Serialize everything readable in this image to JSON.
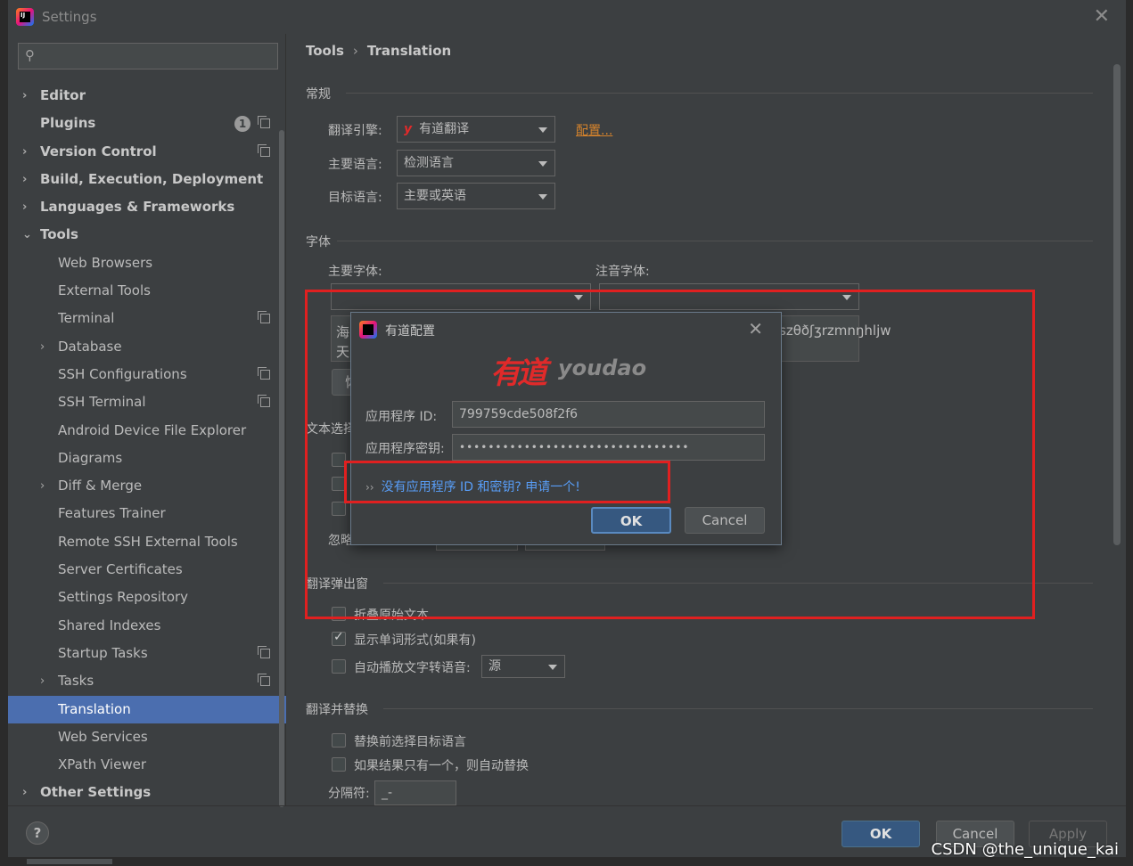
{
  "window": {
    "title": "Settings"
  },
  "search": {
    "placeholder": ""
  },
  "sidebar": {
    "items": [
      {
        "label": "Editor",
        "arrow": "›",
        "bold": true,
        "indent": 0,
        "selected": false
      },
      {
        "label": "Plugins",
        "arrow": "",
        "bold": true,
        "indent": 0,
        "badge": "1",
        "copy": true
      },
      {
        "label": "Version Control",
        "arrow": "›",
        "bold": true,
        "indent": 0,
        "copy": true
      },
      {
        "label": "Build, Execution, Deployment",
        "arrow": "›",
        "bold": true,
        "indent": 0
      },
      {
        "label": "Languages & Frameworks",
        "arrow": "›",
        "bold": true,
        "indent": 0
      },
      {
        "label": "Tools",
        "arrow": "⌄",
        "bold": true,
        "indent": 0
      },
      {
        "label": "Web Browsers",
        "arrow": "",
        "indent": 1
      },
      {
        "label": "External Tools",
        "arrow": "",
        "indent": 1
      },
      {
        "label": "Terminal",
        "arrow": "",
        "indent": 1,
        "copy": true
      },
      {
        "label": "Database",
        "arrow": "›",
        "indent": 1
      },
      {
        "label": "SSH Configurations",
        "arrow": "",
        "indent": 1,
        "copy": true
      },
      {
        "label": "SSH Terminal",
        "arrow": "",
        "indent": 1,
        "copy": true
      },
      {
        "label": "Android Device File Explorer",
        "arrow": "",
        "indent": 1
      },
      {
        "label": "Diagrams",
        "arrow": "",
        "indent": 1
      },
      {
        "label": "Diff & Merge",
        "arrow": "›",
        "indent": 1
      },
      {
        "label": "Features Trainer",
        "arrow": "",
        "indent": 1
      },
      {
        "label": "Remote SSH External Tools",
        "arrow": "",
        "indent": 1
      },
      {
        "label": "Server Certificates",
        "arrow": "",
        "indent": 1
      },
      {
        "label": "Settings Repository",
        "arrow": "",
        "indent": 1
      },
      {
        "label": "Shared Indexes",
        "arrow": "",
        "indent": 1
      },
      {
        "label": "Startup Tasks",
        "arrow": "",
        "indent": 1,
        "copy": true
      },
      {
        "label": "Tasks",
        "arrow": "›",
        "indent": 1,
        "copy": true
      },
      {
        "label": "Translation",
        "arrow": "",
        "indent": 1,
        "selected": true
      },
      {
        "label": "Web Services",
        "arrow": "",
        "indent": 1
      },
      {
        "label": "XPath Viewer",
        "arrow": "",
        "indent": 1
      },
      {
        "label": "Other Settings",
        "arrow": "›",
        "bold": true,
        "indent": 0
      }
    ]
  },
  "breadcrumb": {
    "parent": "Tools",
    "sep": "›",
    "current": "Translation"
  },
  "general": {
    "title": "常规",
    "engine_label": "翻译引擎:",
    "engine_value": "有道翻译",
    "engine_icon": "y",
    "config_link": "配置...",
    "primary_lang_label": "主要语言:",
    "primary_lang_value": "检测语言",
    "target_lang_label": "目标语言:",
    "target_lang_value": "主要或英语"
  },
  "font": {
    "title": "字体",
    "primary_label": "主要字体:",
    "phonetic_label": "注音字体:",
    "preview_line1": "海",
    "preview_line2": "天",
    "preview_phonetic": "szθðʃʒrzmnŋhljw",
    "button_partial": "恢"
  },
  "text_selection": {
    "title_partial": "文本选择",
    "ignore_label_partial": "忽略"
  },
  "popup": {
    "title": "翻译弹出窗",
    "fold_label": "折叠原始文本",
    "show_word_forms_label": "显示单词形式(如果有)",
    "show_word_forms_checked": true,
    "auto_tts_label": "自动播放文字转语音:",
    "auto_tts_value": "源"
  },
  "replace": {
    "title": "翻译并替换",
    "select_target_label": "替换前选择目标语言",
    "auto_replace_label": "如果结果只有一个，则自动替换",
    "separator_label": "分隔符:",
    "separator_value": "_-"
  },
  "footer": {
    "help": "?",
    "ok": "OK",
    "cancel": "Cancel",
    "apply": "Apply",
    "watermark": "CSDN @the_unique_kai"
  },
  "dialog": {
    "title": "有道配置",
    "brand_cn": "有道",
    "brand_en": "youdao",
    "app_id_label": "应用程序 ID:",
    "app_id_value": "799759cde508f2f6",
    "app_key_label": "应用程序密钥:",
    "app_key_value": "••••••••••••••••••••••••••••••••",
    "apply_link": "没有应用程序 ID 和密钥? 申请一个!",
    "ok": "OK",
    "cancel": "Cancel"
  },
  "colors": {
    "accent": "#4b6eaf",
    "primary_button": "#365880",
    "link": "#589df6",
    "config_link": "#d5832c",
    "annotation": "#e02020"
  }
}
